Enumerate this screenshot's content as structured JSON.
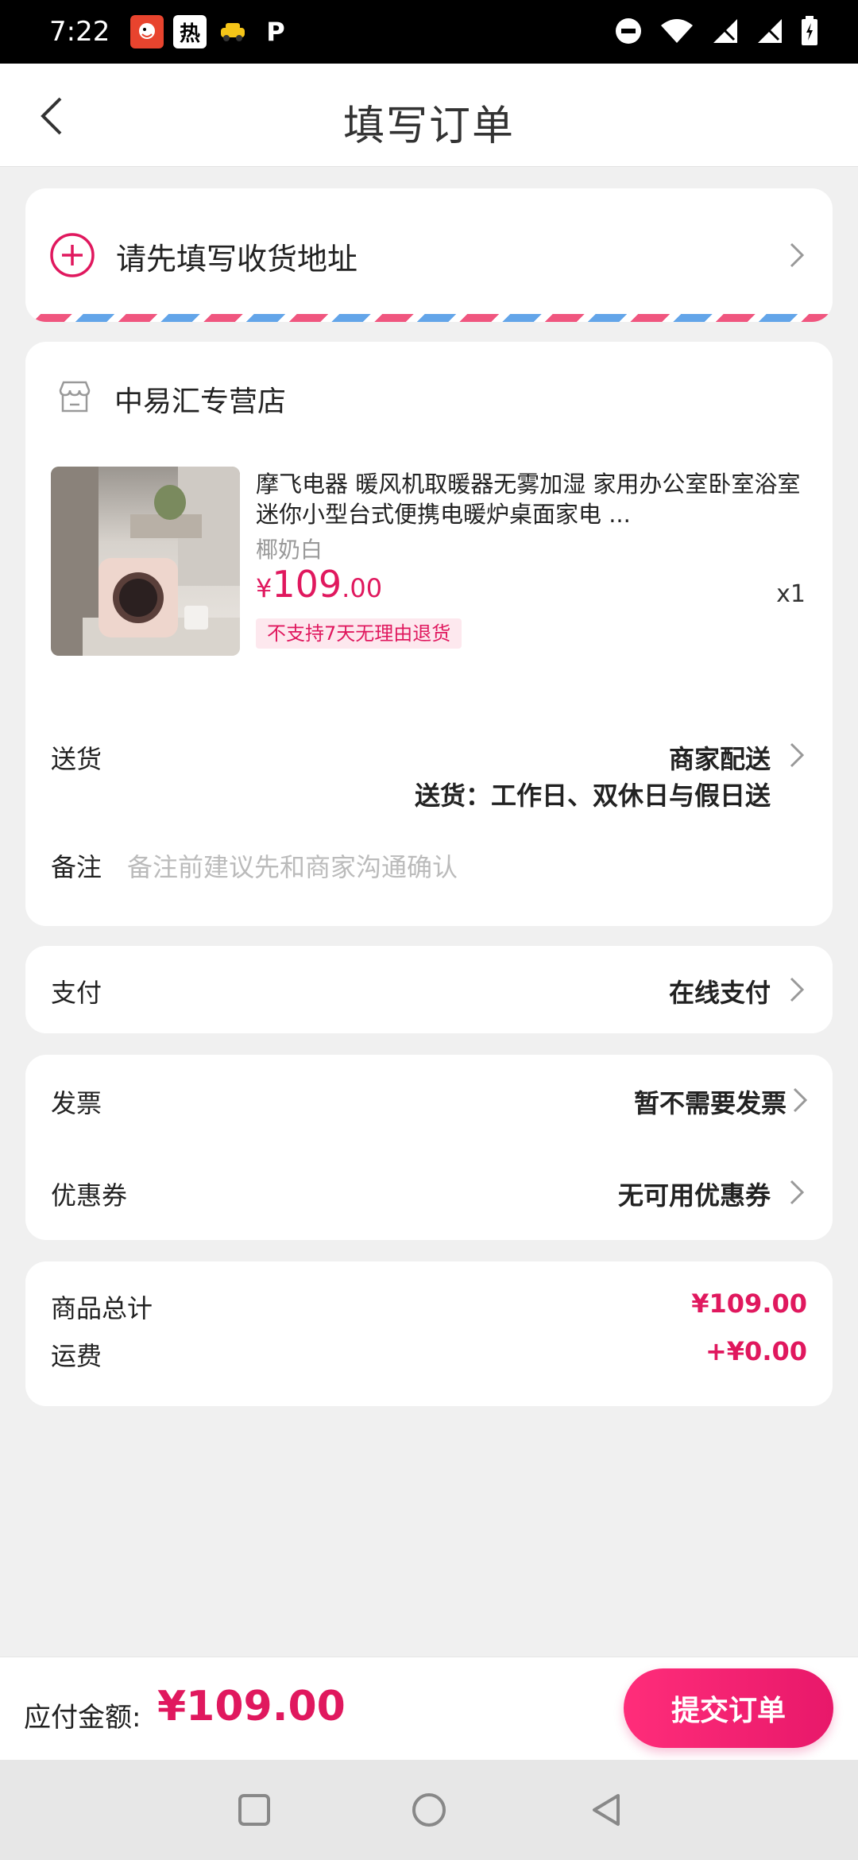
{
  "status_bar": {
    "time": "7:22",
    "app_icon_hot": "热",
    "app_icon_p": "P"
  },
  "header": {
    "title": "填写订单"
  },
  "address": {
    "prompt": "请先填写收货地址"
  },
  "store": {
    "name": "中易汇专营店",
    "product": {
      "title": "摩飞电器 暖风机取暖器无雾加湿 家用办公室卧室浴室迷你小型台式便携电暖炉桌面家电 ...",
      "spec": "椰奶白",
      "price_symbol": "¥",
      "price_int": "109",
      "price_dec": ".00",
      "qty": "x1",
      "tag": "不支持7天无理由退货"
    },
    "delivery": {
      "label": "送货",
      "method": "商家配送",
      "detail": "送货：工作日、双休日与假日送"
    },
    "remark": {
      "label": "备注",
      "placeholder": "备注前建议先和商家沟通确认"
    }
  },
  "payment": {
    "label": "支付",
    "value": "在线支付"
  },
  "invoice": {
    "label": "发票",
    "value": "暂不需要发票"
  },
  "coupon": {
    "label": "优惠券",
    "value": "无可用优惠券"
  },
  "totals": {
    "goods_label": "商品总计",
    "goods_value": "¥109.00",
    "shipping_label": "运费",
    "shipping_value": "+¥0.00"
  },
  "footer": {
    "pay_label": "应付金额:",
    "pay_amount": "¥109.00",
    "submit_label": "提交订单"
  },
  "colors": {
    "accent": "#e0185e",
    "stripe_pink": "#f0567f",
    "stripe_blue": "#63a5e9"
  }
}
